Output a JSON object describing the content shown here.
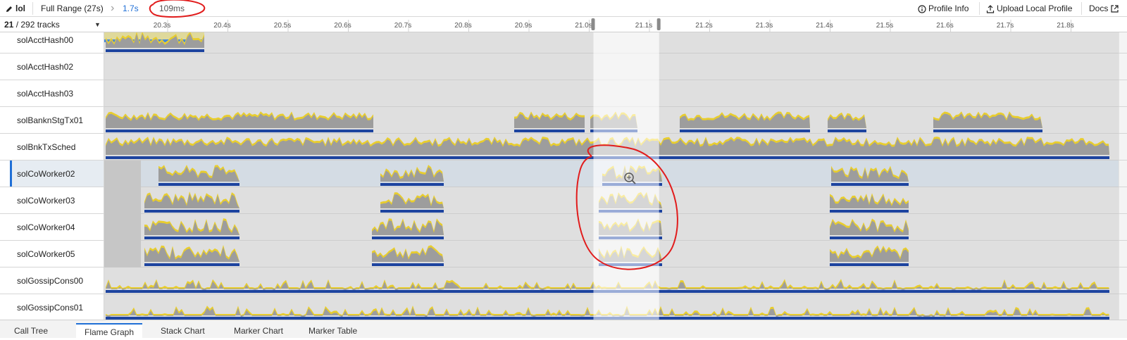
{
  "header": {
    "profile_name": "lol",
    "full_range": "Full Range (27s)",
    "chevron": "›",
    "zoom_range": "1.7s",
    "selection_duration": "109ms",
    "profile_info": "Profile Info",
    "upload": "Upload Local Profile",
    "docs": "Docs"
  },
  "axis": {
    "tracks_visible": "21",
    "tracks_total": "/ 292 tracks",
    "dropdown": "▼",
    "ticks": [
      "20.3s",
      "20.4s",
      "20.5s",
      "20.6s",
      "20.7s",
      "20.8s",
      "20.9s",
      "21.0s",
      "21.1s",
      "21.2s",
      "21.3s",
      "21.4s",
      "21.5s",
      "21.6s",
      "21.7s",
      "21.8s"
    ],
    "tick_values": [
      20.3,
      20.4,
      20.5,
      20.6,
      20.7,
      20.8,
      20.9,
      21.0,
      21.1,
      21.2,
      21.3,
      21.4,
      21.5,
      21.6,
      21.7,
      21.8
    ],
    "selection_start": 21.0,
    "selection_end": 21.109
  },
  "tracks": [
    {
      "name": "solAcctHash00"
    },
    {
      "name": "solAcctHash02"
    },
    {
      "name": "solAcctHash03"
    },
    {
      "name": "solBanknStgTx01"
    },
    {
      "name": "solBnkTxSched"
    },
    {
      "name": "solCoWorker02",
      "selected": true
    },
    {
      "name": "solCoWorker03"
    },
    {
      "name": "solCoWorker04"
    },
    {
      "name": "solCoWorker05"
    },
    {
      "name": "solGossipCons00"
    },
    {
      "name": "solGossipCons01"
    }
  ],
  "bottom_tabs": [
    "Call Tree",
    "Flame Graph",
    "Stack Chart",
    "Marker Chart",
    "Marker Table"
  ],
  "colors": {
    "cpu_gray": "#a4a4a4",
    "cpu_yellow": "#f2d630",
    "sample_blue": "#1f47a6",
    "annotation_red": "#e11c1c",
    "accent": "#1f6fd6"
  }
}
